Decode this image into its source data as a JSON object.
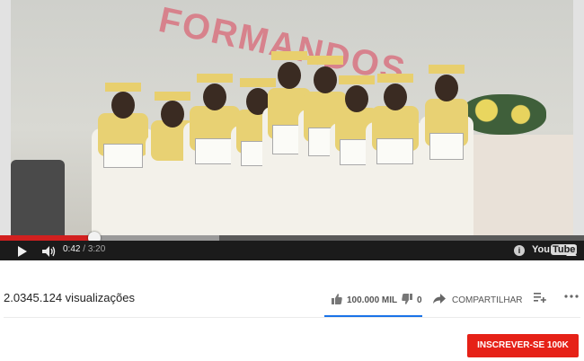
{
  "player": {
    "current_time": "0:42",
    "time_separator": " / ",
    "duration": "3:20",
    "progress_fraction": 0.162,
    "buffer_fraction": 0.375,
    "logo_you": "You",
    "logo_tube": "Tube",
    "info_label": "i"
  },
  "video_scene": {
    "banner_text": "FORMANDOS"
  },
  "meta": {
    "views": "2.0345.124 visualizações",
    "likes": "100.000 MIL",
    "dislikes": "0",
    "share_label": "COMPARTILHAR",
    "subscribe_label": "INSCREVER-SE 100K"
  },
  "colors": {
    "progress": "#d2201f",
    "subscribe": "#e62117",
    "like_bar": "#1a73e8"
  },
  "icons": {
    "play": "play-icon",
    "volume": "volume-icon",
    "info": "info-icon",
    "fullscreen": "fullscreen-icon",
    "like": "thumbs-up-icon",
    "dislike": "thumbs-down-icon",
    "share": "share-arrow-icon",
    "add_to": "add-to-playlist-icon",
    "more": "more-options-icon"
  }
}
